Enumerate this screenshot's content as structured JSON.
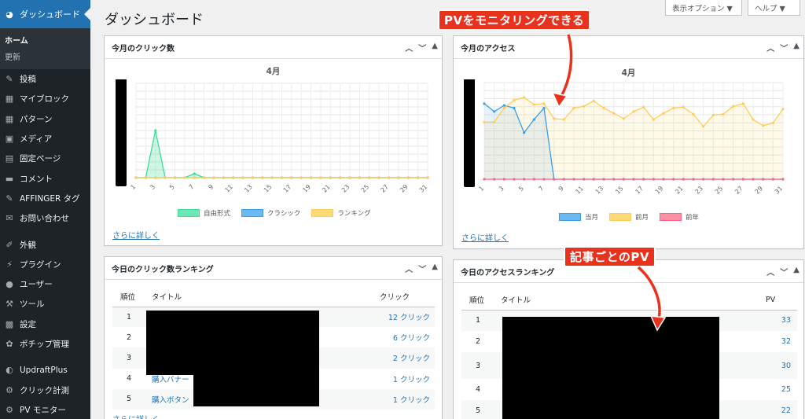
{
  "sidebar": {
    "active_label": "ダッシュボード",
    "sub_items": [
      "ホーム",
      "更新"
    ],
    "items": [
      {
        "label": "投稿",
        "icon": "pin-icon"
      },
      {
        "label": "マイブロック",
        "icon": "grid-icon"
      },
      {
        "label": "パターン",
        "icon": "grid-icon"
      },
      {
        "label": "メディア",
        "icon": "media-icon"
      },
      {
        "label": "固定ページ",
        "icon": "page-icon"
      },
      {
        "label": "コメント",
        "icon": "comment-icon"
      },
      {
        "label": "AFFINGER タグ",
        "icon": "pin-icon"
      },
      {
        "label": "お問い合わせ",
        "icon": "mail-icon"
      },
      {
        "label": "外観",
        "icon": "brush-icon"
      },
      {
        "label": "プラグイン",
        "icon": "plug-icon"
      },
      {
        "label": "ユーザー",
        "icon": "user-icon"
      },
      {
        "label": "ツール",
        "icon": "wrench-icon"
      },
      {
        "label": "設定",
        "icon": "settings-icon"
      },
      {
        "label": "ポチップ管理",
        "icon": "paw-icon"
      },
      {
        "label": "UpdraftPlus",
        "icon": "updraft-icon"
      },
      {
        "label": "クリック計測",
        "icon": "gear-icon"
      },
      {
        "label": "PV モニター",
        "icon": "gear-icon"
      }
    ]
  },
  "header": {
    "title": "ダッシュボード",
    "screen_options": "表示オプション ▼",
    "help": "ヘルプ ▼"
  },
  "panels": {
    "clicks_month": {
      "title": "今月のクリック数",
      "more": "さらに詳しく"
    },
    "access_month": {
      "title": "今月のアクセス",
      "more": "さらに詳しく"
    },
    "clicks_rank": {
      "title": "今日のクリック数ランキング",
      "more": "さらに詳しく",
      "headers": [
        "順位",
        "タイトル",
        "クリック"
      ],
      "rows": [
        {
          "rank": "1",
          "title": "",
          "count": "12 クリック"
        },
        {
          "rank": "2",
          "title": "",
          "count": "6 クリック"
        },
        {
          "rank": "3",
          "title": "",
          "count": "2 クリック"
        },
        {
          "rank": "4",
          "title": "購入バナー",
          "count": "1 クリック"
        },
        {
          "rank": "5",
          "title": "購入ボタン",
          "count": "1 クリック"
        }
      ]
    },
    "access_rank": {
      "title": "今日のアクセスランキング",
      "headers": [
        "順位",
        "タイトル",
        "PV"
      ],
      "rows": [
        {
          "rank": "1",
          "title": "",
          "pv": "33"
        },
        {
          "rank": "2",
          "title": "",
          "pv": "32"
        },
        {
          "rank": "3",
          "title": "",
          "pv": "30"
        },
        {
          "rank": "4",
          "title": "",
          "pv": "25"
        },
        {
          "rank": "5",
          "title": "",
          "pv": "22"
        }
      ]
    }
  },
  "annotations": {
    "pv_monitor": "PVをモニタリングできる",
    "per_article": "記事ごとのPV"
  },
  "chart_data": [
    {
      "type": "area",
      "title": "4月",
      "x": [
        1,
        2,
        3,
        4,
        5,
        6,
        7,
        8,
        9,
        10,
        11,
        12,
        13,
        14,
        15,
        16,
        17,
        18,
        19,
        20,
        21,
        22,
        23,
        24,
        25,
        26,
        27,
        28,
        29,
        30,
        31
      ],
      "tick_labels": [
        "1",
        "3",
        "5",
        "7",
        "9",
        "11",
        "13",
        "15",
        "17",
        "19",
        "21",
        "23",
        "25",
        "27",
        "29",
        "31"
      ],
      "ylim": [
        0,
        12
      ],
      "series": [
        {
          "name": "自由形式",
          "color": "#3ddc97",
          "values": [
            0,
            0,
            6,
            0,
            0,
            0,
            0.5,
            0,
            0,
            0,
            0,
            0,
            0,
            0,
            0,
            0,
            0,
            0,
            0,
            0,
            0,
            0,
            0,
            0,
            0,
            0,
            0,
            0,
            0,
            0,
            0
          ]
        },
        {
          "name": "クラシック",
          "color": "#3b9ee8",
          "values": [
            0,
            0,
            0,
            0,
            0,
            0,
            0,
            0,
            0,
            0,
            0,
            0,
            0,
            0,
            0,
            0,
            0,
            0,
            0,
            0,
            0,
            0,
            0,
            0,
            0,
            0,
            0,
            0,
            0,
            0,
            0
          ]
        },
        {
          "name": "ランキング",
          "color": "#ffcd56",
          "values": [
            0,
            0,
            0,
            0,
            0,
            0,
            0,
            0,
            0,
            0,
            0,
            0,
            0,
            0,
            0,
            0,
            0,
            0,
            0,
            0,
            0,
            0,
            0,
            0,
            0,
            0,
            0,
            0,
            0,
            0,
            0
          ]
        }
      ]
    },
    {
      "type": "area",
      "title": "4月",
      "x": [
        1,
        2,
        3,
        4,
        5,
        6,
        7,
        8,
        9,
        10,
        11,
        12,
        13,
        14,
        15,
        16,
        17,
        18,
        19,
        20,
        21,
        22,
        23,
        24,
        25,
        26,
        27,
        28,
        29,
        30,
        31
      ],
      "tick_labels": [
        "1",
        "3",
        "5",
        "7",
        "9",
        "11",
        "13",
        "15",
        "17",
        "19",
        "21",
        "23",
        "25",
        "27",
        "29",
        "31"
      ],
      "ylim": [
        0,
        11
      ],
      "series": [
        {
          "name": "当月",
          "color": "#3b9ee8",
          "values": [
            8.6,
            7.7,
            8.4,
            8.1,
            5.3,
            6.8,
            8.1,
            0,
            0,
            0,
            0,
            0,
            0,
            0,
            0,
            0,
            0,
            0,
            0,
            0,
            0,
            0,
            0,
            0,
            0,
            0,
            0,
            0,
            0,
            0,
            0
          ]
        },
        {
          "name": "前月",
          "color": "#ffcd56",
          "values": [
            6.5,
            6.5,
            8.1,
            9.0,
            9.3,
            8.5,
            8.6,
            6.9,
            6.8,
            8.1,
            8.3,
            8.9,
            8.1,
            7.5,
            6.9,
            7.7,
            8.2,
            6.8,
            7.5,
            8.1,
            8.2,
            7.4,
            6.0,
            7.3,
            7.4,
            8.3,
            8.6,
            6.8,
            6.1,
            6.4,
            8.0
          ]
        },
        {
          "name": "前年",
          "color": "#ff6384",
          "values": [
            0,
            0,
            0,
            0,
            0,
            0,
            0,
            0,
            0,
            0,
            0,
            0,
            0,
            0,
            0,
            0,
            0,
            0,
            0,
            0,
            0,
            0,
            0,
            0,
            0,
            0,
            0,
            0,
            0,
            0,
            0
          ]
        }
      ]
    }
  ]
}
